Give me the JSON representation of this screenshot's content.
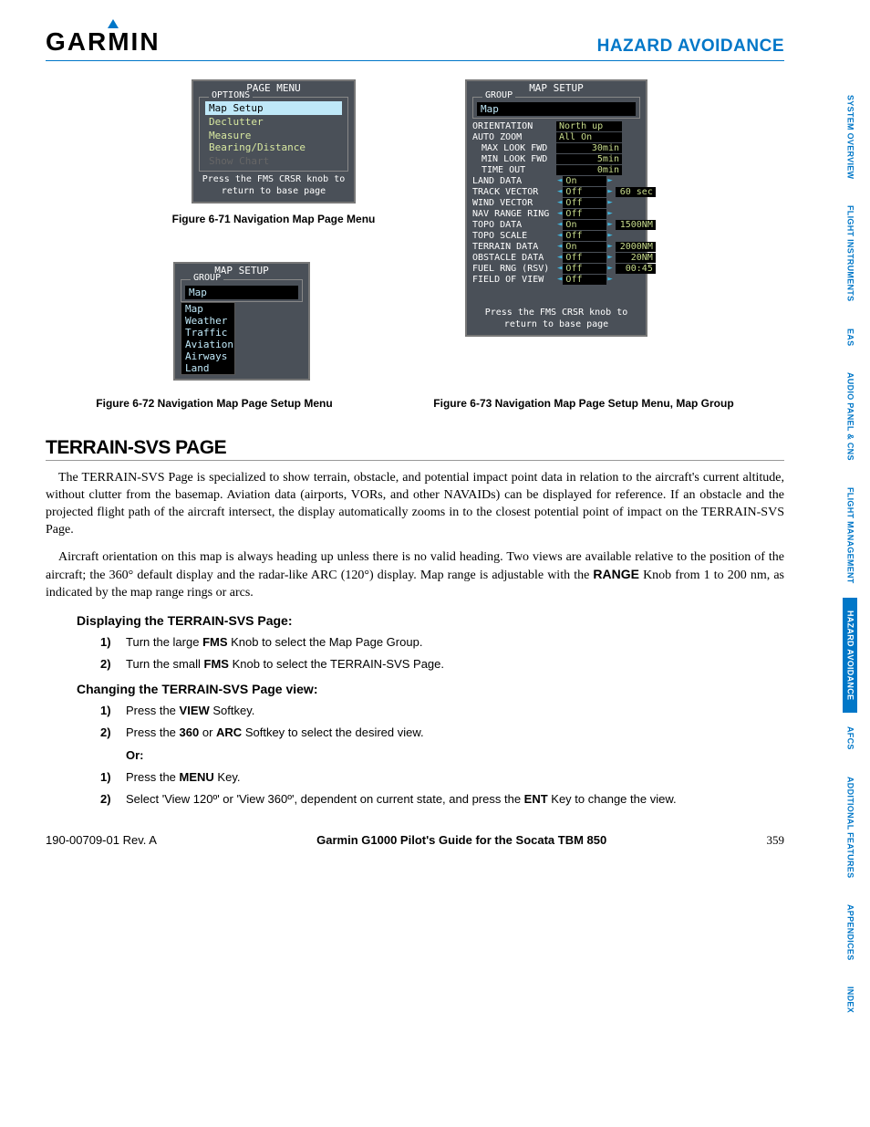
{
  "header": {
    "logo": "GARMIN",
    "chapter": "HAZARD AVOIDANCE"
  },
  "tabs": [
    {
      "label": "SYSTEM OVERVIEW",
      "active": false
    },
    {
      "label": "FLIGHT INSTRUMENTS",
      "active": false
    },
    {
      "label": "EAS",
      "active": false
    },
    {
      "label": "AUDIO PANEL & CNS",
      "active": false
    },
    {
      "label": "FLIGHT MANAGEMENT",
      "active": false
    },
    {
      "label": "HAZARD AVOIDANCE",
      "active": true
    },
    {
      "label": "AFCS",
      "active": false
    },
    {
      "label": "ADDITIONAL FEATURES",
      "active": false
    },
    {
      "label": "APPENDICES",
      "active": false
    },
    {
      "label": "INDEX",
      "active": false
    }
  ],
  "figures": {
    "fig71": {
      "title": "PAGE MENU",
      "legend": "OPTIONS",
      "options": [
        {
          "text": "Map Setup",
          "sel": true
        },
        {
          "text": "Declutter",
          "sel": false
        },
        {
          "text": "Measure Bearing/Distance",
          "sel": false
        },
        {
          "text": "Show Chart",
          "dis": true
        }
      ],
      "hint1": "Press the FMS CRSR knob to",
      "hint2": "return to base page",
      "caption": "Figure 6-71  Navigation Map Page Menu"
    },
    "fig72": {
      "title": "MAP SETUP",
      "legend": "GROUP",
      "selected": "Map",
      "dropdown": [
        "Map",
        "Weather",
        "Traffic",
        "Aviation",
        "Airways",
        "Land"
      ],
      "caption": "Figure 6-72  Navigation Map Page Setup Menu"
    },
    "fig73": {
      "title": "MAP SETUP",
      "legend": "GROUP",
      "selected": "Map",
      "settings": [
        {
          "label": "ORIENTATION",
          "val": "North up",
          "sub": false,
          "arrows": false,
          "extra": ""
        },
        {
          "label": "AUTO ZOOM",
          "val": "All On",
          "sub": false,
          "arrows": false,
          "extra": ""
        },
        {
          "label": "MAX LOOK FWD",
          "val": "30min",
          "sub": true,
          "arrows": false,
          "right": true,
          "extra": ""
        },
        {
          "label": "MIN LOOK FWD",
          "val": "5min",
          "sub": true,
          "arrows": false,
          "right": true,
          "extra": ""
        },
        {
          "label": "TIME OUT",
          "val": "0min",
          "sub": true,
          "arrows": false,
          "right": true,
          "extra": ""
        },
        {
          "label": "LAND DATA",
          "val": "On",
          "sub": false,
          "arrows": true,
          "extra": ""
        },
        {
          "label": "TRACK VECTOR",
          "val": "Off",
          "sub": false,
          "arrows": true,
          "extra": "60 sec"
        },
        {
          "label": "WIND VECTOR",
          "val": "Off",
          "sub": false,
          "arrows": true,
          "extra": ""
        },
        {
          "label": "NAV RANGE RING",
          "val": "Off",
          "sub": false,
          "arrows": true,
          "extra": ""
        },
        {
          "label": "TOPO DATA",
          "val": "On",
          "sub": false,
          "arrows": true,
          "extra": "1500NM"
        },
        {
          "label": "TOPO SCALE",
          "val": "Off",
          "sub": false,
          "arrows": true,
          "extra": ""
        },
        {
          "label": "TERRAIN DATA",
          "val": "On",
          "sub": false,
          "arrows": true,
          "extra": "2000NM"
        },
        {
          "label": "OBSTACLE DATA",
          "val": "Off",
          "sub": false,
          "arrows": true,
          "extra": "20NM"
        },
        {
          "label": "FUEL RNG (RSV)",
          "val": "Off",
          "sub": false,
          "arrows": true,
          "extra": "00:45"
        },
        {
          "label": "FIELD OF VIEW",
          "val": "Off",
          "sub": false,
          "arrows": true,
          "extra": ""
        }
      ],
      "hint1": "Press the FMS CRSR knob to",
      "hint2": "return to base page",
      "caption": "Figure 6-73  Navigation Map Page Setup Menu, Map Group"
    }
  },
  "section": {
    "heading": "TERRAIN-SVS PAGE",
    "p1": "The TERRAIN-SVS Page is specialized to show terrain, obstacle, and potential impact point data in relation to the aircraft's current altitude, without clutter from the basemap.  Aviation data (airports, VORs, and other NAVAIDs) can be displayed for reference.  If an obstacle and the projected flight path of the aircraft intersect, the display automatically zooms in to the closest potential point of impact on the TERRAIN-SVS Page.",
    "p2a": "Aircraft orientation on this map is always heading up unless there is no valid heading.  Two views are available relative to the position of the aircraft; the 360° default display and the radar-like ARC (120°) display.  Map range is adjustable with the ",
    "p2b_bold": "RANGE",
    "p2c": " Knob from 1 to 200 nm, as indicated by the map range rings or arcs.",
    "subh1": "Displaying the TERRAIN-SVS Page:",
    "disp_steps": [
      {
        "n": "1)",
        "a": "Turn the large ",
        "b": "FMS",
        "c": " Knob to select the Map Page Group."
      },
      {
        "n": "2)",
        "a": "Turn the small ",
        "b": "FMS",
        "c": " Knob to select the TERRAIN-SVS Page."
      }
    ],
    "subh2": "Changing the TERRAIN-SVS Page view:",
    "chg_steps1": [
      {
        "n": "1)",
        "a": "Press the ",
        "b": "VIEW",
        "c": " Softkey."
      },
      {
        "n": "2)",
        "a": "Press the ",
        "b": "360",
        "c": " or ",
        "b2": "ARC",
        "c2": " Softkey to select the desired view."
      }
    ],
    "or": "Or",
    "chg_steps2": [
      {
        "n": "1)",
        "a": "Press the ",
        "b": "MENU",
        "c": " Key."
      },
      {
        "n": "2)",
        "a": "Select 'View 120º' or 'View 360º', dependent on current state, and press the ",
        "b": "ENT",
        "c": " Key to change the view."
      }
    ]
  },
  "footer": {
    "left": "190-00709-01  Rev. A",
    "center": "Garmin G1000 Pilot's Guide for the Socata TBM 850",
    "right": "359"
  }
}
